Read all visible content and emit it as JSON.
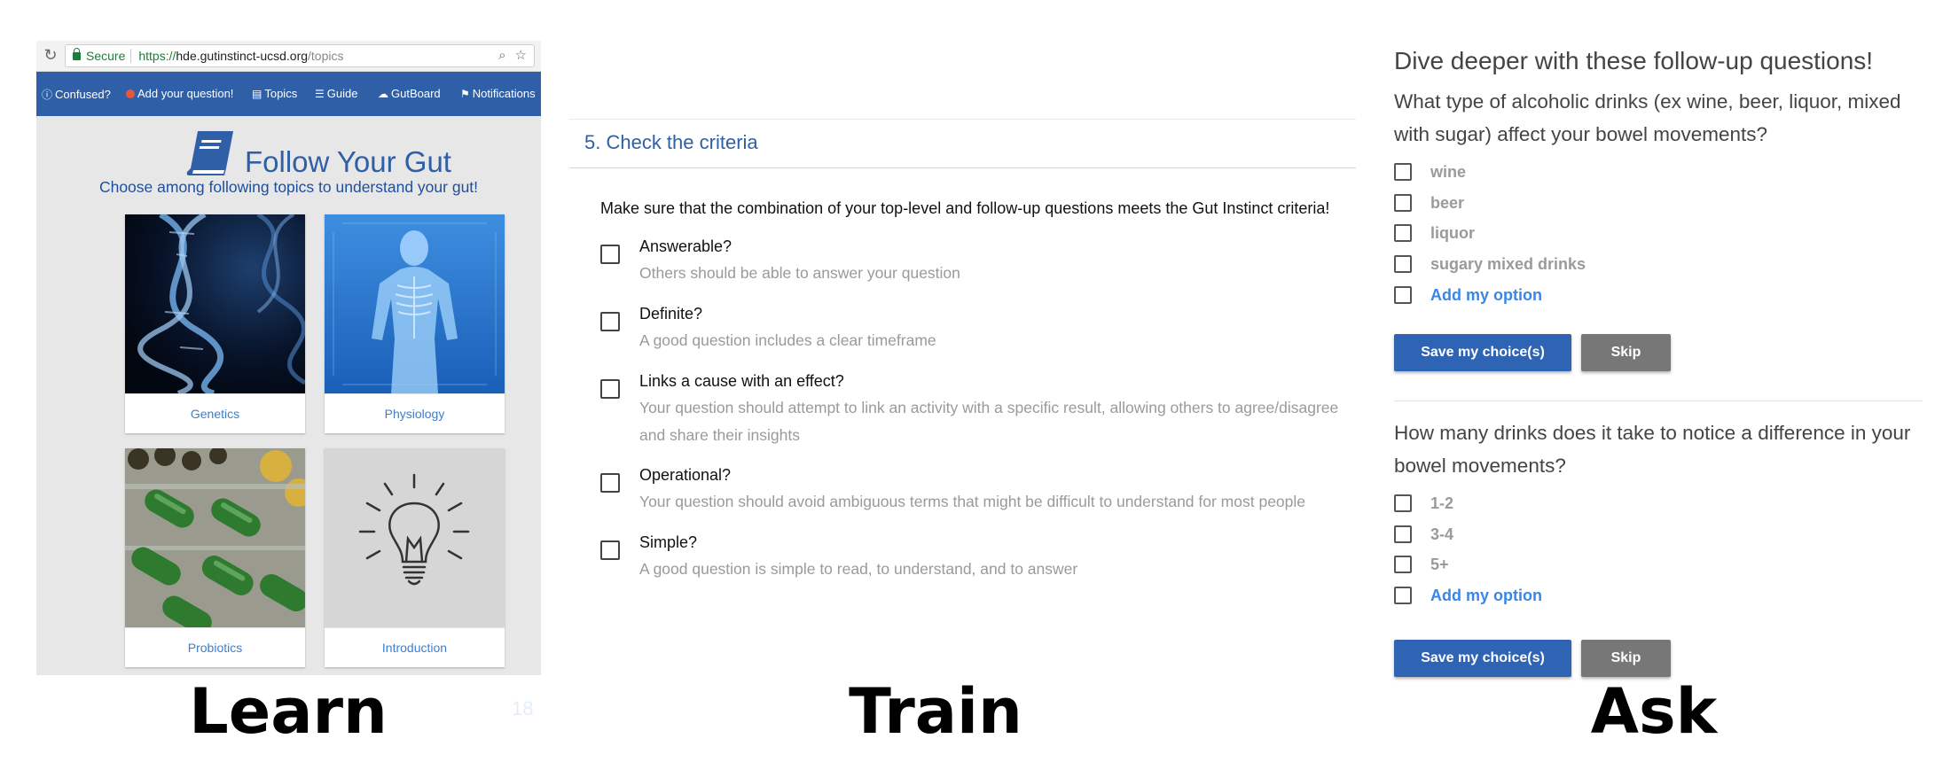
{
  "learn": {
    "browser": {
      "secure_label": "Secure",
      "url_scheme": "https://",
      "url_host": "hde.gutinstinct-ucsd.org",
      "url_path": "/topics"
    },
    "nav": {
      "confused": "Confused?",
      "add_question": "Add your question!",
      "topics": "Topics",
      "guide": "Guide",
      "gutboard": "GutBoard",
      "notifications": "Notifications"
    },
    "title": "Follow Your Gut",
    "subtitle": "Choose among following topics to understand your gut!",
    "topics": [
      {
        "label": "Genetics",
        "icon": "dna-image"
      },
      {
        "label": "Physiology",
        "icon": "body-scan-image"
      },
      {
        "label": "Probiotics",
        "icon": "pills-image"
      },
      {
        "label": "Introduction",
        "icon": "lightbulb-image"
      }
    ],
    "page_number": "18"
  },
  "train": {
    "title": "5. Check the criteria",
    "intro": "Make sure that the combination of your top-level and follow-up questions meets the Gut Instinct criteria!",
    "criteria": [
      {
        "title": "Answerable?",
        "desc": "Others should be able to answer your question"
      },
      {
        "title": "Definite?",
        "desc": "A good question includes a clear timeframe"
      },
      {
        "title": "Links a cause with an effect?",
        "desc": "Your question should attempt to link an activity with a specific result, allowing others to agree/disagree and share their insights"
      },
      {
        "title": "Operational?",
        "desc": "Your question should avoid ambiguous terms that might be difficult to understand for most people"
      },
      {
        "title": "Simple?",
        "desc": "A good question is simple to read, to understand, and to answer"
      }
    ]
  },
  "ask": {
    "heading": "Dive deeper with these follow-up questions!",
    "questions": [
      {
        "text": "What type of alcoholic drinks (ex wine, beer, liquor, mixed with sugar) affect your bowel movements?",
        "options": [
          "wine",
          "beer",
          "liquor",
          "sugary mixed drinks"
        ],
        "add_option": "Add my option",
        "save": "Save my choice(s)",
        "skip": "Skip"
      },
      {
        "text": "How many drinks does it take to notice a difference in your bowel movements?",
        "options": [
          "1-2",
          "3-4",
          "5+"
        ],
        "add_option": "Add my option",
        "save": "Save my choice(s)",
        "skip": "Skip"
      }
    ]
  },
  "labels": {
    "learn": "Learn",
    "train": "Train",
    "ask": "Ask"
  },
  "colors": {
    "nav_blue": "#2f5fa7",
    "link_blue": "#3a7fd0",
    "button_blue": "#2f63b4",
    "button_gray": "#777777"
  }
}
